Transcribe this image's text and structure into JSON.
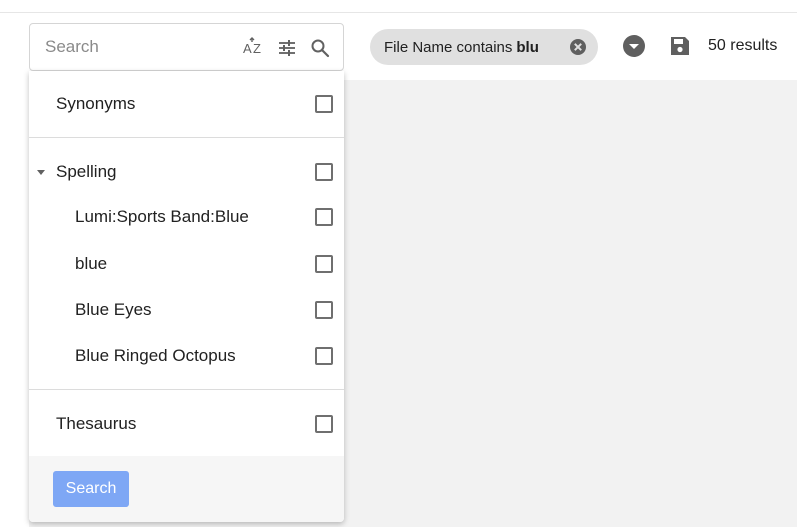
{
  "search": {
    "placeholder": "Search"
  },
  "filter_chip": {
    "prefix": "File Name contains",
    "value": "blu"
  },
  "results_text": "50 results",
  "icons": {
    "sort": "sort-az-icon",
    "filter": "tune-icon",
    "search": "search-icon",
    "chip_close": "close-circle-icon",
    "dropdown": "dropdown-circle-icon",
    "save": "save-icon",
    "caret": "caret-down-icon"
  },
  "panel": {
    "synonyms": {
      "label": "Synonyms",
      "checked": false
    },
    "spelling": {
      "label": "Spelling",
      "checked": false,
      "expanded": true,
      "items": [
        {
          "label": "Lumi:Sports Band:Blue",
          "checked": false
        },
        {
          "label": "blue",
          "checked": false
        },
        {
          "label": "Blue Eyes",
          "checked": false
        },
        {
          "label": "Blue Ringed Octopus",
          "checked": false
        }
      ]
    },
    "thesaurus": {
      "label": "Thesaurus",
      "checked": false
    },
    "search_button": "Search"
  },
  "colors": {
    "accent_button": "#7ea7f5",
    "chip_bg": "#e0e0e0",
    "content_bg": "#f2f2f2"
  }
}
